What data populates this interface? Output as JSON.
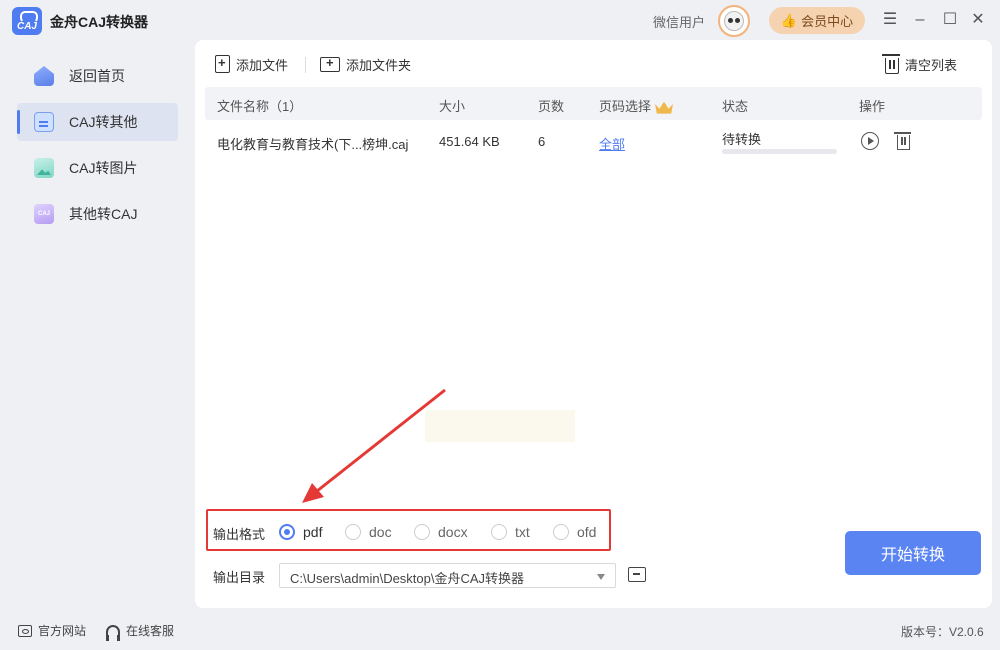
{
  "app": {
    "title": "金舟CAJ转换器",
    "logo_text": "CAJ"
  },
  "header": {
    "user_name": "微信用户",
    "vip_label": "会员中心",
    "menu_icon": "hamburger-icon",
    "minimize_icon": "minimize-icon",
    "maximize_icon": "maximize-icon",
    "close_icon": "close-icon"
  },
  "sidebar": {
    "items": [
      {
        "label": "返回首页",
        "icon": "home-icon",
        "active": false
      },
      {
        "label": "CAJ转其他",
        "icon": "document-icon",
        "active": true
      },
      {
        "label": "CAJ转图片",
        "icon": "image-icon",
        "active": false
      },
      {
        "label": "其他转CAJ",
        "icon": "caj-icon",
        "active": false
      }
    ]
  },
  "toolbar": {
    "add_file": "添加文件",
    "add_folder": "添加文件夹",
    "clear_list": "清空列表"
  },
  "table": {
    "headers": {
      "name": "文件名称（1）",
      "size": "大小",
      "pages": "页数",
      "page_select": "页码选择",
      "status": "状态",
      "actions": "操作"
    },
    "rows": [
      {
        "name": "电化教育与教育技术(下...榜坤.caj",
        "size": "451.64 KB",
        "pages": "6",
        "page_select": "全部",
        "status": "待转换",
        "progress": 0
      }
    ]
  },
  "output": {
    "format_label": "输出格式",
    "formats": [
      "pdf",
      "doc",
      "docx",
      "txt",
      "ofd"
    ],
    "selected_format": "pdf",
    "dir_label": "输出目录",
    "dir_value": "C:\\Users\\admin\\Desktop\\金舟CAJ转换器"
  },
  "actions": {
    "start": "开始转换"
  },
  "footer": {
    "website": "官方网站",
    "support": "在线客服",
    "version": "版本号：V2.0.6"
  },
  "colors": {
    "accent": "#4f7cf0",
    "highlight_box": "#e53935",
    "vip": "#f6d3b0"
  }
}
